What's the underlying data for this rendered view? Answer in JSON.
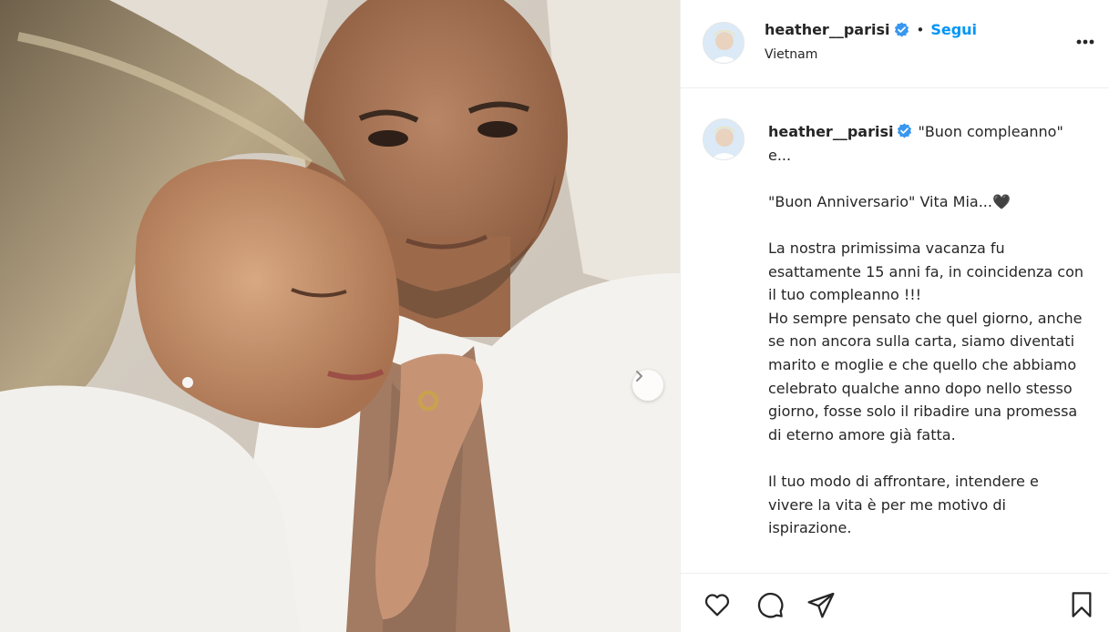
{
  "post": {
    "username": "heather__parisi",
    "verified": true,
    "follow_label": "Segui",
    "separator": "•",
    "location": "Vietnam",
    "caption": "\"Buon compleanno\" e...\n\n\"Buon Anniversario\" Vita Mia...🖤\n\nLa nostra primissima vacanza fu esattamente 15 anni fa, in coincidenza con il tuo compleanno !!!\nHo sempre pensato che quel giorno, anche se non ancora sulla carta, siamo diventati marito e moglie e che quello che abbiamo celebrato qualche anno dopo nello stesso giorno, fosse solo il ribadire una promessa di eterno amore già fatta.\n\nIl tuo modo di affrontare, intendere e vivere la vita è per me motivo di ispirazione."
  },
  "icons": {
    "more": "more-options-icon",
    "verified": "verified-badge-icon",
    "next": "chevron-right-icon",
    "like": "heart-icon",
    "comment": "comment-icon",
    "share": "paper-plane-icon",
    "save": "bookmark-icon"
  },
  "colors": {
    "accent": "#0095f6",
    "verified": "#3897f0",
    "text": "#262626",
    "border": "#efefef"
  }
}
